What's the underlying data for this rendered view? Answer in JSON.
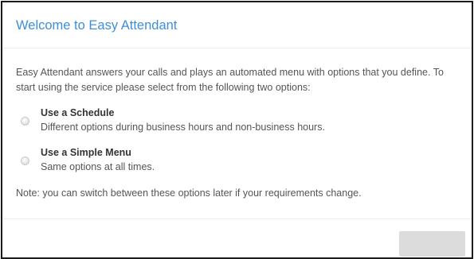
{
  "dialog": {
    "title": "Welcome to Easy Attendant",
    "intro": "Easy Attendant answers your calls and plays an automated menu with options that you define. To start using the service please select from the following two options:",
    "options": [
      {
        "label": "Use a Schedule",
        "description": "Different options during business hours and non-business hours.",
        "selected": false
      },
      {
        "label": "Use a Simple Menu",
        "description": "Same options at all times.",
        "selected": false
      }
    ],
    "note": "Note: you can switch between these options later if your requirements change.",
    "next_button": {
      "label": "",
      "enabled": false
    }
  },
  "colors": {
    "title": "#3d8fd6",
    "text": "#555555",
    "border": "#1a1a1a",
    "button_disabled": "#dcdcdc"
  }
}
